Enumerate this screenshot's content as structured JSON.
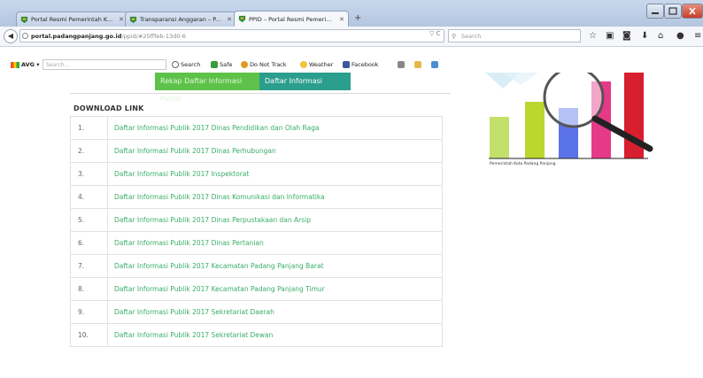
{
  "browser": {
    "tabs": [
      {
        "label": "Portal Resmi Pemerintah K...",
        "active": false
      },
      {
        "label": "Transparansi Anggaran – P...",
        "active": false
      },
      {
        "label": "PPID – Portal Resmi Pemeri...",
        "active": true
      }
    ],
    "new_tab_symbol": "+",
    "url_host": "portal.padangpanjang.go.id",
    "url_path": "/ppid/#25fffeb-13d0-6",
    "reload_symbol": "▽ C",
    "search_placeholder": "Search",
    "nav_icons": [
      "star-icon",
      "bookmarks-icon",
      "pocket-icon",
      "download-icon",
      "home-icon",
      "chat-icon",
      "menu-icon"
    ]
  },
  "avg_toolbar": {
    "brand": "AVG",
    "dropdown": "▾",
    "search_placeholder": "Search...",
    "items": [
      {
        "label": "Search",
        "icon": "search-icon"
      },
      {
        "label": "Safe",
        "icon": "shield-icon"
      },
      {
        "label": "Do Not Track",
        "icon": "eye-icon"
      },
      {
        "label": "Weather",
        "icon": "weather-icon"
      },
      {
        "label": "Facebook",
        "icon": "facebook-icon"
      }
    ]
  },
  "page": {
    "tabs": {
      "rekap": "Rekap Daftar Informasi Publik",
      "daftar": "Daftar Informasi Publik"
    },
    "download_heading": "DOWNLOAD LINK",
    "rows": [
      {
        "num": "1.",
        "text": "Daftar Informasi Publik 2017 Dinas Pendidikan dan Olah Raga"
      },
      {
        "num": "2.",
        "text": "Daftar Informasi Publik 2017 Dinas Perhubungan"
      },
      {
        "num": "3.",
        "text": "Daftar Informasi Publik 2017 Inspektorat"
      },
      {
        "num": "4.",
        "text": "Daftar Informasi Publik 2017 Dinas Komunikasi dan Informatika"
      },
      {
        "num": "5.",
        "text": "Daftar Informasi Publik 2017 Dinas Perpustakaan dan Arsip"
      },
      {
        "num": "6.",
        "text": "Daftar Informasi Publik 2017 Dinas Pertanian"
      },
      {
        "num": "7.",
        "text": "Daftar Informasi Publik 2017 Kecamatan Padang Panjang Barat"
      },
      {
        "num": "8.",
        "text": "Daftar Informasi Publik 2017 Kecamatan Padang Panjang Timur"
      },
      {
        "num": "9.",
        "text": "Daftar Informasi Publik 2017 Sekretariat Daerah"
      },
      {
        "num": "10.",
        "text": "Daftar Informasi Publik 2017 Sekretariat Dewan"
      }
    ],
    "sidebar_caption": "Pemerintah Kota Padang Panjang",
    "colors": {
      "tab_rekap": "#5ec24a",
      "tab_daftar": "#2b9e8d",
      "link": "#3aae6a",
      "bar_colors": [
        "#c3e06a",
        "#bcd630",
        "#5b73e8",
        "#e53a87",
        "#d81f30"
      ]
    }
  }
}
